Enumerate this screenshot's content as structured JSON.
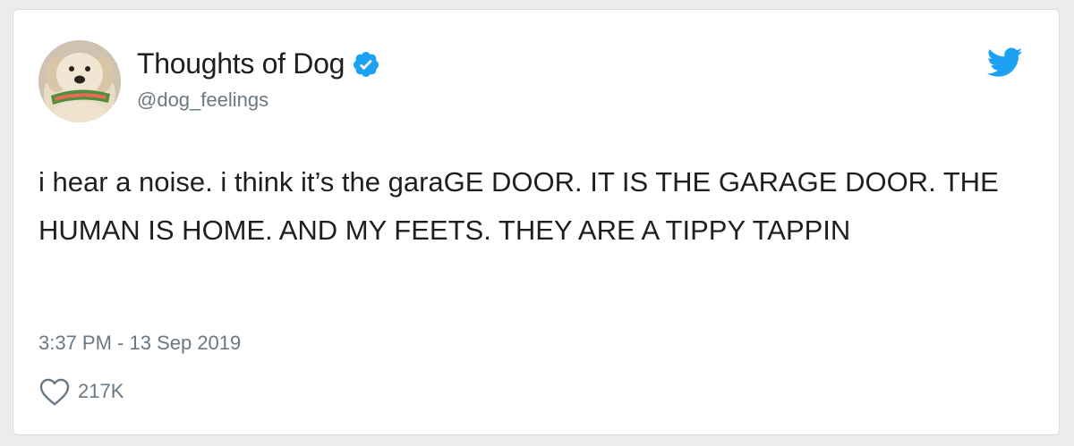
{
  "author": {
    "display_name": "Thoughts of Dog",
    "handle": "@dog_feelings",
    "verified": true,
    "avatar_icon": "dog-holding-watermelon-avatar"
  },
  "tweet": {
    "text": "i hear a noise. i think it’s the garaGE DOOR. IT IS THE GARAGE DOOR. THE HUMAN IS HOME. AND MY FEETS. THEY ARE A TIPPY TAPPIN",
    "timestamp": "3:37 PM - 13 Sep 2019",
    "likes": "217K"
  },
  "icons": {
    "verified": "verified-badge-icon",
    "brand": "twitter-bird-icon",
    "like": "heart-icon"
  },
  "colors": {
    "text_primary": "#1c2022",
    "text_secondary": "#697882",
    "twitter_blue": "#1da1f2",
    "card_background": "#ffffff"
  }
}
